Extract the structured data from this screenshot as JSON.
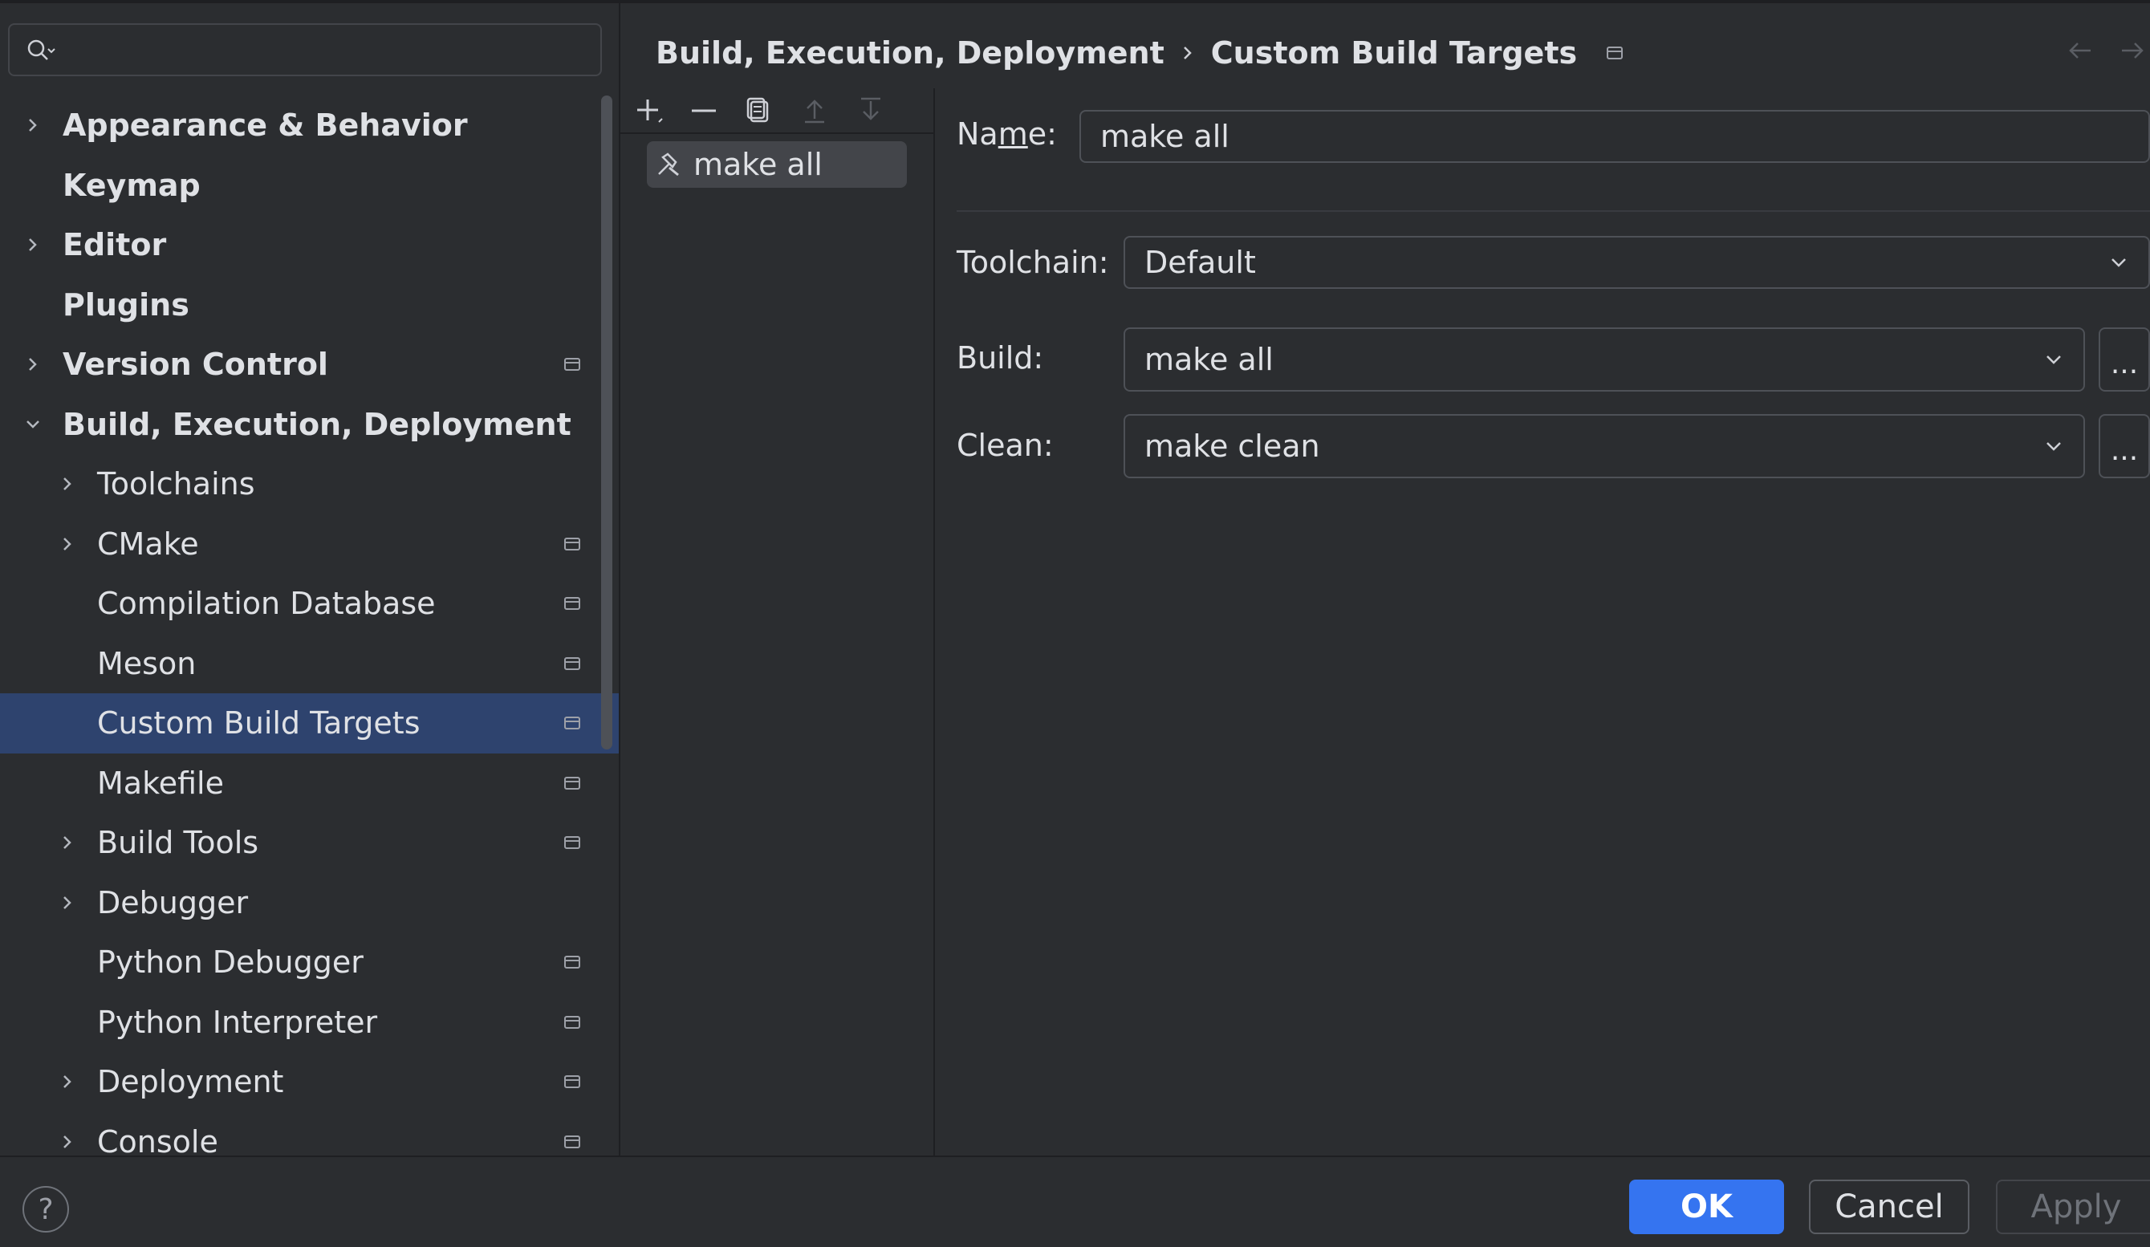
{
  "search": {
    "placeholder": ""
  },
  "sidebar": {
    "items": [
      {
        "label": "Appearance & Behavior",
        "level": 0,
        "expandable": true,
        "expanded": false,
        "bold": true,
        "pinned": false
      },
      {
        "label": "Keymap",
        "level": 0,
        "expandable": false,
        "bold": true,
        "pinned": false
      },
      {
        "label": "Editor",
        "level": 0,
        "expandable": true,
        "expanded": false,
        "bold": true,
        "pinned": false
      },
      {
        "label": "Plugins",
        "level": 0,
        "expandable": false,
        "bold": true,
        "pinned": false
      },
      {
        "label": "Version Control",
        "level": 0,
        "expandable": true,
        "expanded": false,
        "bold": true,
        "pinned": true
      },
      {
        "label": "Build, Execution, Deployment",
        "level": 0,
        "expandable": true,
        "expanded": true,
        "bold": true,
        "pinned": false
      },
      {
        "label": "Toolchains",
        "level": 1,
        "expandable": true,
        "expanded": false,
        "bold": false,
        "pinned": false
      },
      {
        "label": "CMake",
        "level": 1,
        "expandable": true,
        "expanded": false,
        "bold": false,
        "pinned": true
      },
      {
        "label": "Compilation Database",
        "level": 1,
        "expandable": false,
        "bold": false,
        "pinned": true
      },
      {
        "label": "Meson",
        "level": 1,
        "expandable": false,
        "bold": false,
        "pinned": true
      },
      {
        "label": "Custom Build Targets",
        "level": 1,
        "expandable": false,
        "bold": false,
        "pinned": true,
        "selected": true
      },
      {
        "label": "Makefile",
        "level": 1,
        "expandable": false,
        "bold": false,
        "pinned": true
      },
      {
        "label": "Build Tools",
        "level": 1,
        "expandable": true,
        "expanded": false,
        "bold": false,
        "pinned": true
      },
      {
        "label": "Debugger",
        "level": 1,
        "expandable": true,
        "expanded": false,
        "bold": false,
        "pinned": false
      },
      {
        "label": "Python Debugger",
        "level": 1,
        "expandable": false,
        "bold": false,
        "pinned": true
      },
      {
        "label": "Python Interpreter",
        "level": 1,
        "expandable": false,
        "bold": false,
        "pinned": true
      },
      {
        "label": "Deployment",
        "level": 1,
        "expandable": true,
        "expanded": false,
        "bold": false,
        "pinned": true
      },
      {
        "label": "Console",
        "level": 1,
        "expandable": true,
        "expanded": false,
        "bold": false,
        "pinned": true
      }
    ]
  },
  "breadcrumb": {
    "parent": "Build, Execution, Deployment",
    "current": "Custom Build Targets"
  },
  "targets": {
    "items": [
      "make all"
    ]
  },
  "form": {
    "name_label_pre": "Na",
    "name_label_mnemonic": "m",
    "name_label_post": "e:",
    "name_value": "make all",
    "toolchain_label": "Toolchain:",
    "toolchain_value": "Default",
    "build_label": "Build:",
    "build_value": "make all",
    "clean_label": "Clean:",
    "clean_value": "make clean",
    "browse_label": "..."
  },
  "footer": {
    "help": "?",
    "ok": "OK",
    "cancel": "Cancel",
    "apply": "Apply"
  },
  "colors": {
    "accent": "#3574f0",
    "selection": "#2e436e",
    "background": "#2b2d30"
  }
}
